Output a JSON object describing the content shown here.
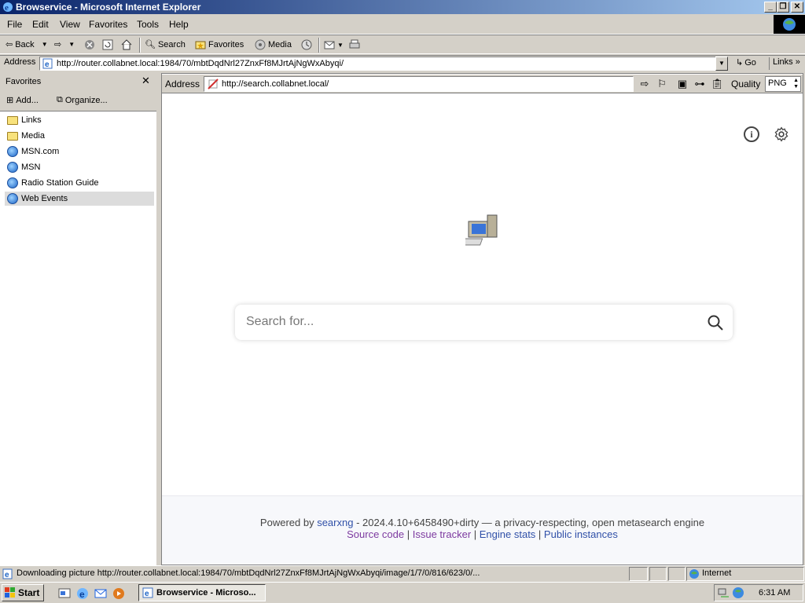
{
  "window": {
    "title": "Browservice - Microsoft Internet Explorer",
    "min": "_",
    "max": "❐",
    "close": "✕"
  },
  "menu": [
    "File",
    "Edit",
    "View",
    "Favorites",
    "Tools",
    "Help"
  ],
  "toolbar": {
    "back": "Back",
    "search": "Search",
    "favorites": "Favorites",
    "media": "Media"
  },
  "address": {
    "label": "Address",
    "url": "http://router.collabnet.local:1984/70/mbtDqdNrl27ZnxFf8MJrtAjNgWxAbyqi/",
    "go": "Go",
    "links": "Links"
  },
  "favorites": {
    "title": "Favorites",
    "add": "Add...",
    "organize": "Organize...",
    "items": [
      {
        "label": "Links",
        "icon": "folder-icon"
      },
      {
        "label": "Media",
        "icon": "folder-icon"
      },
      {
        "label": "MSN.com",
        "icon": "ie-link-icon"
      },
      {
        "label": "MSN",
        "icon": "ie-link-icon"
      },
      {
        "label": "Radio Station Guide",
        "icon": "ie-link-icon"
      },
      {
        "label": "Web Events",
        "icon": "ie-link-icon",
        "selected": true
      }
    ]
  },
  "inner": {
    "address_label": "Address",
    "url": "http://search.collabnet.local/",
    "quality_label": "Quality",
    "quality_value": "PNG"
  },
  "search": {
    "placeholder": "Search for..."
  },
  "footer": {
    "powered": "Powered by",
    "searxng": "searxng",
    "version_text": " - 2024.4.10+6458490+dirty — a privacy-respecting, open metasearch engine",
    "source": "Source code",
    "tracker": "Issue tracker",
    "stats": "Engine stats",
    "instances": "Public instances",
    "sep": " | "
  },
  "status": {
    "text": "Downloading picture http://router.collabnet.local:1984/70/mbtDqdNrl27ZnxFf8MJrtAjNgWxAbyqi/image/1/7/0/816/623/0/...",
    "zone": "Internet"
  },
  "taskbar": {
    "start": "Start",
    "task": "Browservice - Microso...",
    "clock": "6:31 AM"
  },
  "colors": {
    "titlebar": "#0a246a",
    "link_purple": "#7d3aa0",
    "link_blue": "#3050a8"
  }
}
